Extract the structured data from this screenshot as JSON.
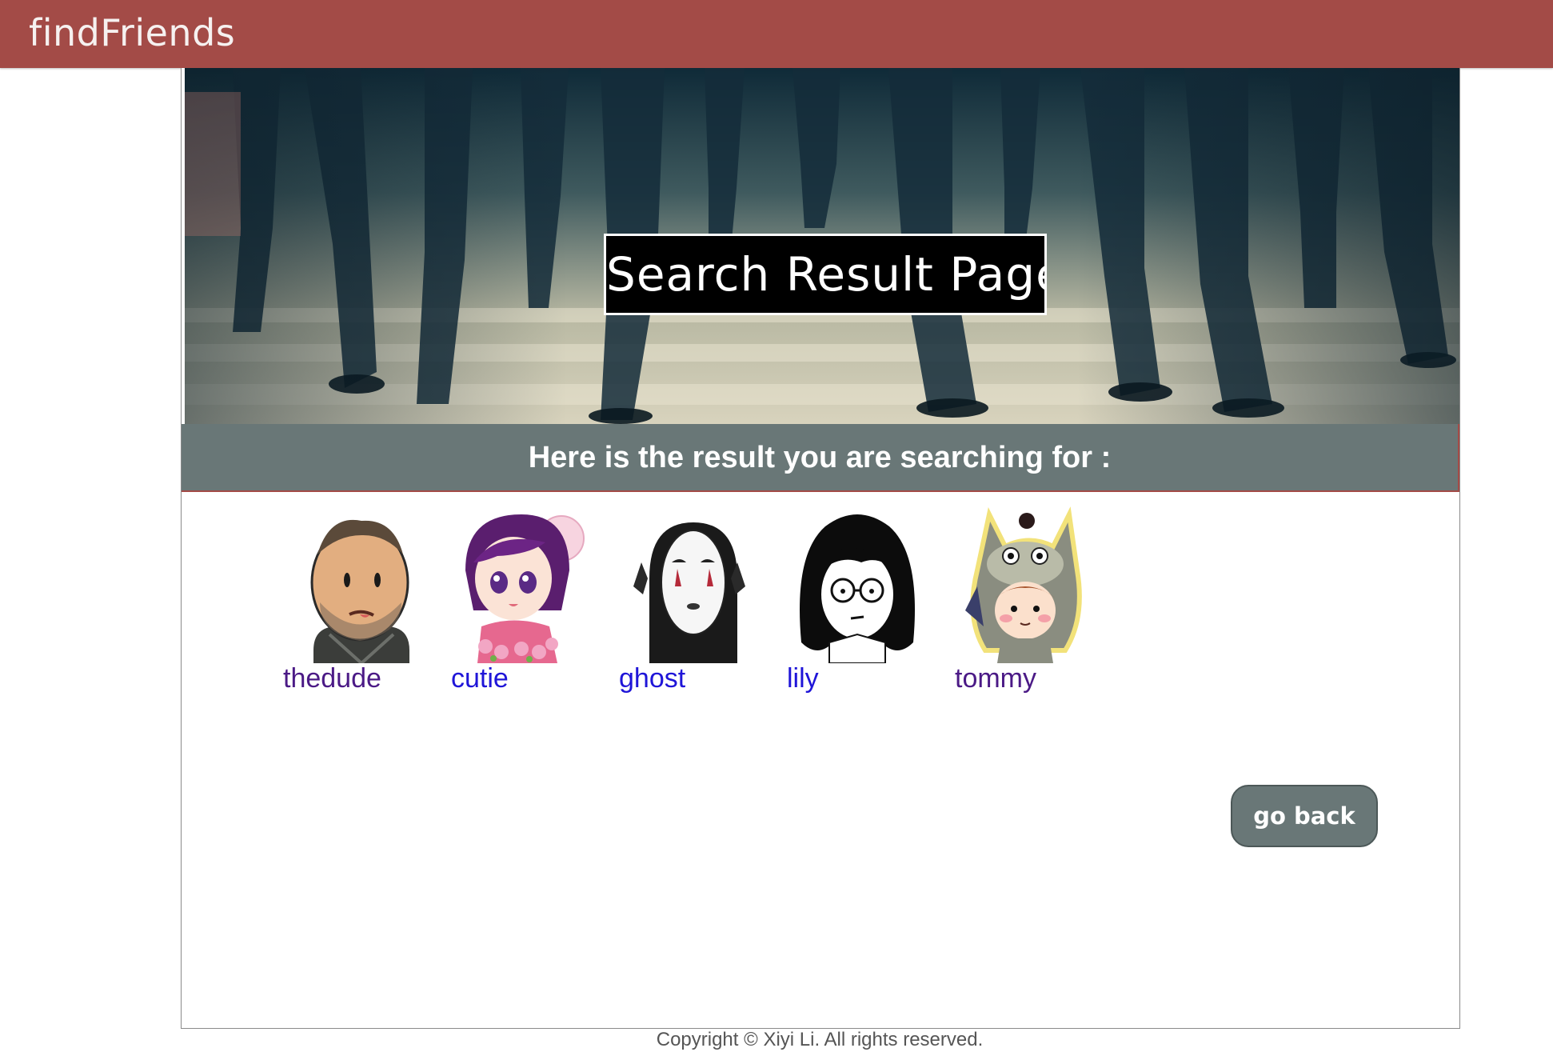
{
  "app": {
    "brand": "findFriends"
  },
  "hero": {
    "title": "Search Result Page"
  },
  "results": {
    "heading": "Here is the result you are searching for :",
    "friends": [
      {
        "name": "thedude",
        "link_color": "#4b1a86",
        "avatar": "bald-bearded-man-cartoon"
      },
      {
        "name": "cutie",
        "link_color": "#1f15d8",
        "avatar": "anime-girl-purple-hair"
      },
      {
        "name": "ghost",
        "link_color": "#1f15d8",
        "avatar": "no-face-spirit-mask"
      },
      {
        "name": "lily",
        "link_color": "#1f15d8",
        "avatar": "black-hair-girl-glasses"
      },
      {
        "name": "tommy",
        "link_color": "#4b1a86",
        "avatar": "boy-in-totoro-costume"
      }
    ]
  },
  "actions": {
    "go_back_label": "go back"
  },
  "footer": {
    "copyright": "Copyright © Xiyi Li. All rights reserved."
  },
  "colors": {
    "topbar": "#a34b47",
    "result_bar": "#697777",
    "button": "#697777"
  }
}
